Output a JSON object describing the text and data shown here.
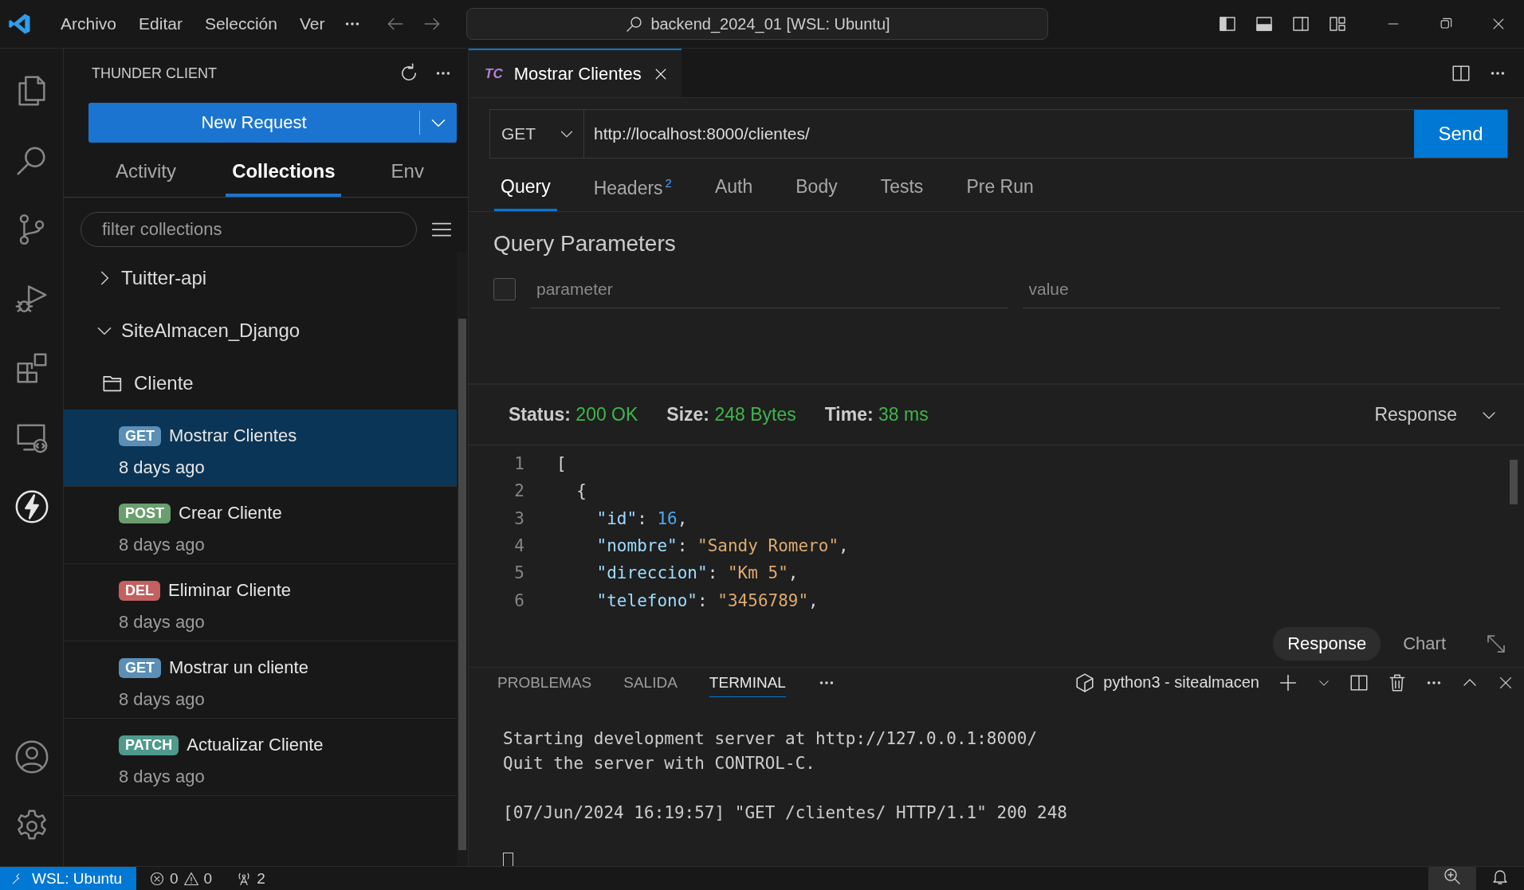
{
  "titlebar": {
    "menu": [
      "Archivo",
      "Editar",
      "Selección",
      "Ver"
    ],
    "search": "backend_2024_01 [WSL: Ubuntu]"
  },
  "activity_bar": [
    {
      "kind": "files",
      "selected": false
    },
    {
      "kind": "search",
      "selected": false
    },
    {
      "kind": "git",
      "selected": false
    },
    {
      "kind": "debug",
      "selected": false
    },
    {
      "kind": "extensions",
      "selected": false
    },
    {
      "kind": "remote",
      "selected": false
    },
    {
      "kind": "thunder",
      "selected": true
    },
    {
      "kind": "account",
      "selected": false
    },
    {
      "kind": "settings",
      "selected": false
    }
  ],
  "sidebar": {
    "title": "THUNDER CLIENT",
    "new_request": "New Request",
    "tabs": [
      {
        "label": "Activity",
        "selected": false
      },
      {
        "label": "Collections",
        "selected": true
      },
      {
        "label": "Env",
        "selected": false
      }
    ],
    "filter": {
      "placeholder": "filter collections"
    },
    "tree": [
      {
        "kind": "collection",
        "label": "Tuitter-api",
        "expanded": false
      },
      {
        "kind": "collection",
        "label": "SiteAlmacen_Django",
        "expanded": true,
        "children": [
          {
            "kind": "folder",
            "label": "Cliente",
            "children": [
              {
                "kind": "request",
                "method": "GET",
                "color": "#5b8fb5",
                "label": "Mostrar Clientes",
                "time": "8 days ago",
                "selected": true
              },
              {
                "kind": "request",
                "method": "POST",
                "color": "#6b9e6f",
                "label": "Crear Cliente",
                "time": "8 days ago",
                "selected": false
              },
              {
                "kind": "request",
                "method": "DEL",
                "color": "#c46060",
                "label": "Eliminar Cliente",
                "time": "8 days ago",
                "selected": false
              },
              {
                "kind": "request",
                "method": "GET",
                "color": "#5b8fb5",
                "label": "Mostrar un cliente",
                "time": "8 days ago",
                "selected": false
              },
              {
                "kind": "request",
                "method": "PATCH",
                "color": "#4f9a8c",
                "label": "Actualizar Cliente",
                "time": "8 days ago",
                "selected": false
              }
            ]
          }
        ]
      }
    ]
  },
  "editor": {
    "tab": {
      "badge": "TC",
      "title": "Mostrar Clientes"
    },
    "method": "GET",
    "url": "http://localhost:8000/clientes/",
    "send": "Send",
    "tabs": [
      {
        "label": "Query",
        "selected": true
      },
      {
        "label": "Headers",
        "count": "2",
        "selected": false
      },
      {
        "label": "Auth",
        "selected": false
      },
      {
        "label": "Body",
        "selected": false
      },
      {
        "label": "Tests",
        "selected": false
      },
      {
        "label": "Pre Run",
        "selected": false
      }
    ],
    "query": {
      "title": "Query Parameters",
      "rows": [
        {
          "checked": false,
          "key_placeholder": "parameter",
          "value_placeholder": "value"
        }
      ]
    },
    "response": {
      "stats": [
        {
          "label": "Status:",
          "value": "200 OK"
        },
        {
          "label": "Size:",
          "value": "248 Bytes"
        },
        {
          "label": "Time:",
          "value": "38 ms"
        }
      ],
      "view": "Response",
      "lines": [
        {
          "number": "1",
          "tokens": [
            {
              "kind": "punct",
              "text": "["
            }
          ]
        },
        {
          "number": "2",
          "tokens": [
            {
              "kind": "punct",
              "text": "  {"
            }
          ]
        },
        {
          "number": "3",
          "tokens": [
            {
              "kind": "key",
              "text": "    \"id\""
            },
            {
              "kind": "punct",
              "text": ": "
            },
            {
              "kind": "number",
              "text": "16"
            },
            {
              "kind": "punct",
              "text": ","
            }
          ]
        },
        {
          "number": "4",
          "tokens": [
            {
              "kind": "key",
              "text": "    \"nombre\""
            },
            {
              "kind": "punct",
              "text": ": "
            },
            {
              "kind": "string",
              "text": "\"Sandy Romero\""
            },
            {
              "kind": "punct",
              "text": ","
            }
          ]
        },
        {
          "number": "5",
          "tokens": [
            {
              "kind": "key",
              "text": "    \"direccion\""
            },
            {
              "kind": "punct",
              "text": ": "
            },
            {
              "kind": "string",
              "text": "\"Km 5\""
            },
            {
              "kind": "punct",
              "text": ","
            }
          ]
        },
        {
          "number": "6",
          "tokens": [
            {
              "kind": "key",
              "text": "    \"telefono\""
            },
            {
              "kind": "punct",
              "text": ": "
            },
            {
              "kind": "string",
              "text": "\"3456789\""
            },
            {
              "kind": "punct",
              "text": ","
            }
          ]
        }
      ],
      "toggles": [
        {
          "label": "Response",
          "selected": true
        },
        {
          "label": "Chart",
          "selected": false
        }
      ]
    }
  },
  "panel": {
    "tabs": [
      {
        "label": "PROBLEMAS",
        "selected": false
      },
      {
        "label": "SALIDA",
        "selected": false
      },
      {
        "label": "TERMINAL",
        "selected": true
      }
    ],
    "terminal_name": "python3 - sitealmacen",
    "blocks": [
      [
        "Starting development server at http://127.0.0.1:8000/",
        "Quit the server with CONTROL-C."
      ],
      [
        "[07/Jun/2024 16:19:57] \"GET /clientes/ HTTP/1.1\" 200 248"
      ]
    ]
  },
  "status_bar": {
    "remote": "WSL: Ubuntu",
    "errors": "0",
    "warnings": "0",
    "ports": "2"
  }
}
